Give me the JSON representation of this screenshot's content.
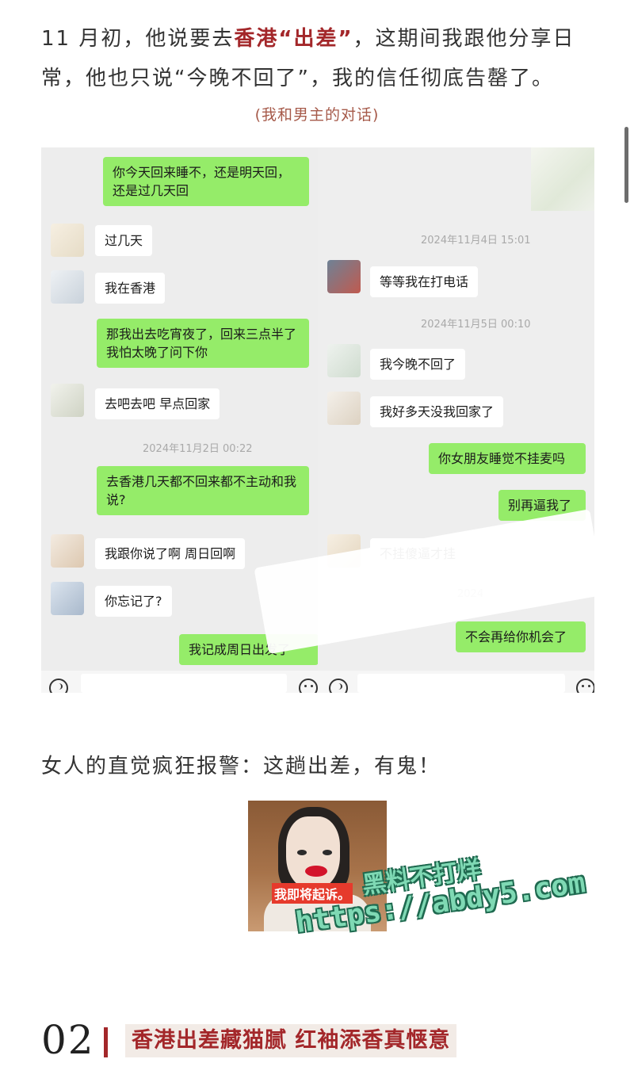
{
  "intro": {
    "line1_pre": "11 月初，他说要去",
    "line1_hl": "香港“出差”",
    "line1_post": "，这期间我跟他分享日",
    "line2": "常，他也只说“今晚不回了”，我的信任彻底告罄了。"
  },
  "caption": "(我和男主的对话)",
  "chat_left": {
    "messages": [
      {
        "side": "me",
        "text": "你今天回来睡不，还是明天回，还是过几天回"
      },
      {
        "side": "other",
        "text": "过几天"
      },
      {
        "side": "other",
        "text": "我在香港"
      },
      {
        "side": "me",
        "text": "那我出去吃宵夜了，回来三点半了我怕太晚了问下你"
      },
      {
        "side": "other",
        "text": "去吧去吧 早点回家"
      },
      {
        "side": "me",
        "text": "去香港几天都不回来都不主动和我说?"
      },
      {
        "side": "other",
        "text": "我跟你说了啊 周日回啊"
      },
      {
        "side": "other",
        "text": "你忘记了?"
      },
      {
        "side": "me",
        "text": "我记成周日出发了"
      }
    ],
    "timestamp": "2024年11月2日 00:22"
  },
  "chat_right": {
    "timestamps": [
      "2024年11月4日 15:01",
      "2024年11月5日 00:10",
      "2024"
    ],
    "messages": [
      {
        "side": "other",
        "text": "等等我在打电话"
      },
      {
        "side": "other",
        "text": "我今晚不回了"
      },
      {
        "side": "other",
        "text": "我好多天没我回家了"
      },
      {
        "side": "me",
        "text": "你女朋友睡觉不挂麦吗"
      },
      {
        "side": "me",
        "text": "别再逼我了"
      },
      {
        "side": "other",
        "text": "不挂傻逼才挂"
      },
      {
        "side": "me",
        "text": "不会再给你机会了"
      }
    ]
  },
  "body_text": "女人的直觉疯狂报警：这趟出差，有鬼！",
  "meme": {
    "label": "我即将起诉。"
  },
  "watermark": {
    "line1": "黑料不打烊",
    "line2": "https://abdy5.com"
  },
  "section": {
    "number": "02",
    "title": "香港出差藏猫腻 红袖添香真惬意"
  },
  "colors": {
    "accent": "#a3272a",
    "wechat_green": "#95ec69",
    "watermark": "#7fd9b4"
  }
}
